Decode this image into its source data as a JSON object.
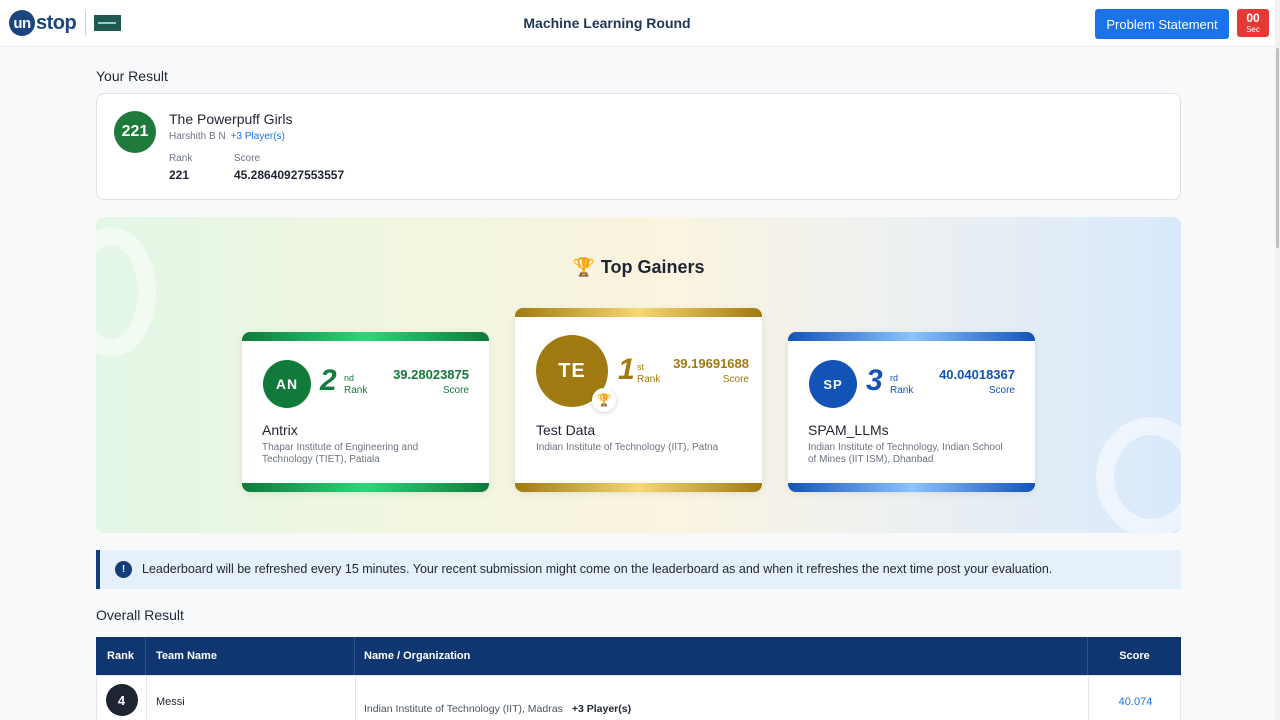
{
  "header": {
    "logo_text": "un",
    "logo_text2": "stop",
    "title": "Machine Learning Round",
    "problem_button": "Problem Statement",
    "timer_value": "00",
    "timer_unit": "Sec"
  },
  "your_result": {
    "section_title": "Your Result",
    "rank_badge": "221",
    "team_name": "The Powerpuff Girls",
    "leader": "Harshith B N",
    "players": "+3 Player(s)",
    "rank_label": "Rank",
    "rank_value": "221",
    "score_label": "Score",
    "score_value": "45.28640927553557"
  },
  "top_gainers": {
    "title": "Top Gainers",
    "cards": [
      {
        "initials": "AN",
        "position": "2",
        "suffix": "nd",
        "rank_label": "Rank",
        "score": "39.28023875",
        "score_label": "Score",
        "name": "Antrix",
        "org": "Thapar Institute of Engineering and Technology (TIET), Patiala",
        "color": "#0f7a3a"
      },
      {
        "initials": "TE",
        "position": "1",
        "suffix": "st",
        "rank_label": "Rank",
        "score": "39.19691688",
        "score_label": "Score",
        "name": "Test Data",
        "org": "Indian Institute of Technology (IIT), Patna",
        "color": "#a07a10"
      },
      {
        "initials": "SP",
        "position": "3",
        "suffix": "rd",
        "rank_label": "Rank",
        "score": "40.04018367",
        "score_label": "Score",
        "name": "SPAM_LLMs",
        "org": "Indian Institute of Technology, Indian School of Mines (IIT ISM), Dhanbad",
        "color": "#1253b8"
      }
    ]
  },
  "notice": {
    "text": "Leaderboard will be refreshed every 15 minutes. Your recent submission might come on the leaderboard as and when it refreshes the next time post your evaluation."
  },
  "overall": {
    "section_title": "Overall Result",
    "columns": [
      "Rank",
      "Team Name",
      "Name / Organization",
      "Score"
    ],
    "rows": [
      {
        "rank": "4",
        "team": "Messi",
        "org": "Indian Institute of Technology (IIT), Madras",
        "players": "+3 Player(s)",
        "score": "40.074"
      }
    ]
  }
}
